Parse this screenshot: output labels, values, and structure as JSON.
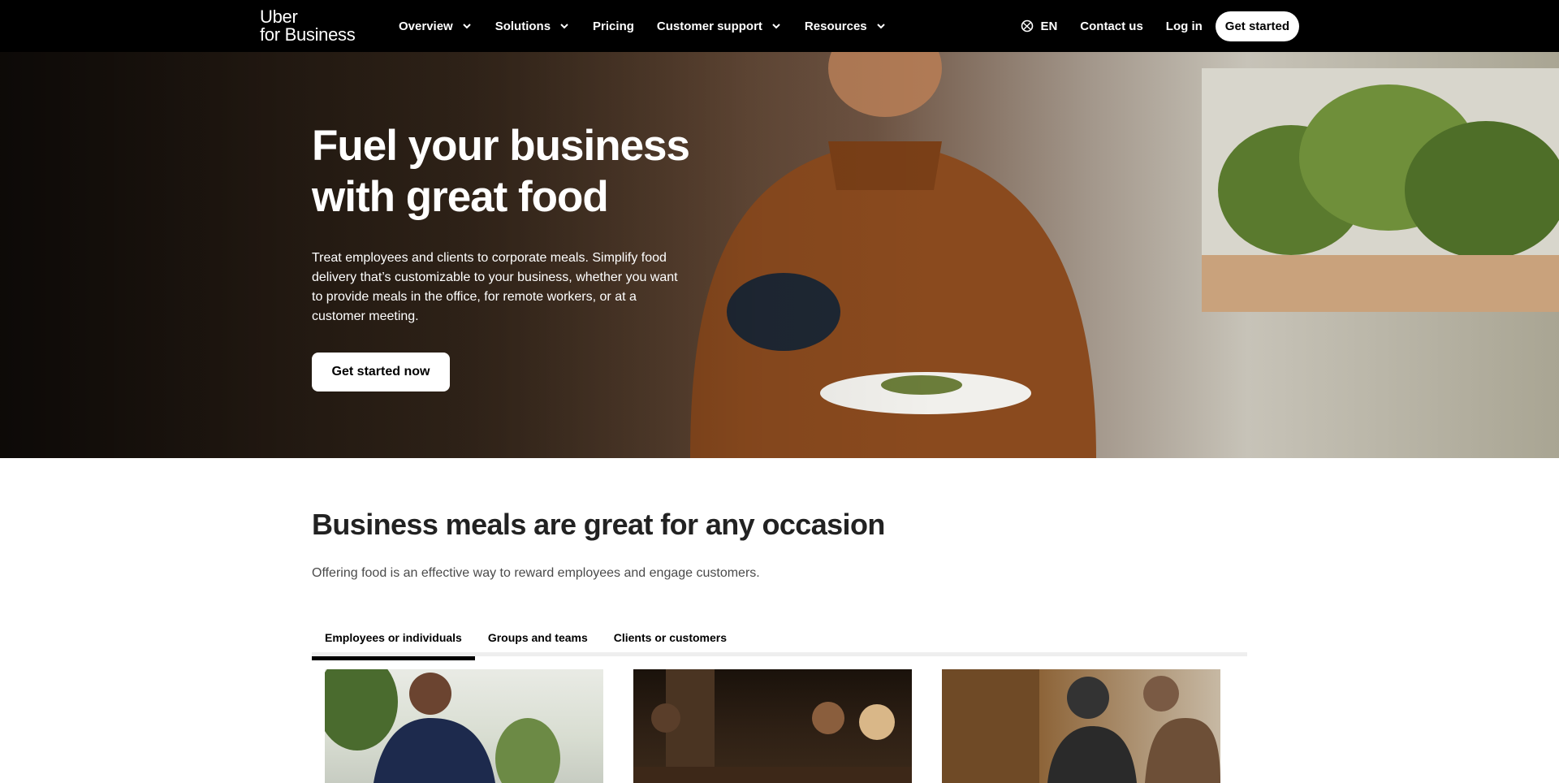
{
  "nav": {
    "brand_line1": "Uber",
    "brand_line2": "for Business",
    "items": [
      {
        "label": "Overview",
        "has_dropdown": true
      },
      {
        "label": "Solutions",
        "has_dropdown": true
      },
      {
        "label": "Pricing",
        "has_dropdown": false
      },
      {
        "label": "Customer support",
        "has_dropdown": true
      },
      {
        "label": "Resources",
        "has_dropdown": true
      }
    ],
    "language": "EN",
    "contact": "Contact us",
    "login": "Log in",
    "get_started": "Get started"
  },
  "hero": {
    "title": "Fuel your business with great food",
    "description": "Treat employees and clients to corporate meals. Simplify food delivery that’s customizable to your business, whether you want to provide meals in the office, for remote workers, or at a customer meeting.",
    "cta": "Get started now"
  },
  "section": {
    "title": "Business meals are great for any occasion",
    "description": "Offering food is an effective way to reward employees and engage customers.",
    "tabs": [
      {
        "label": "Employees or individuals",
        "active": true
      },
      {
        "label": "Groups and teams",
        "active": false
      },
      {
        "label": "Clients or customers",
        "active": false
      }
    ]
  },
  "colors": {
    "nav_bg": "#000000",
    "accent": "#000000",
    "page_bg": "#ffffff"
  }
}
